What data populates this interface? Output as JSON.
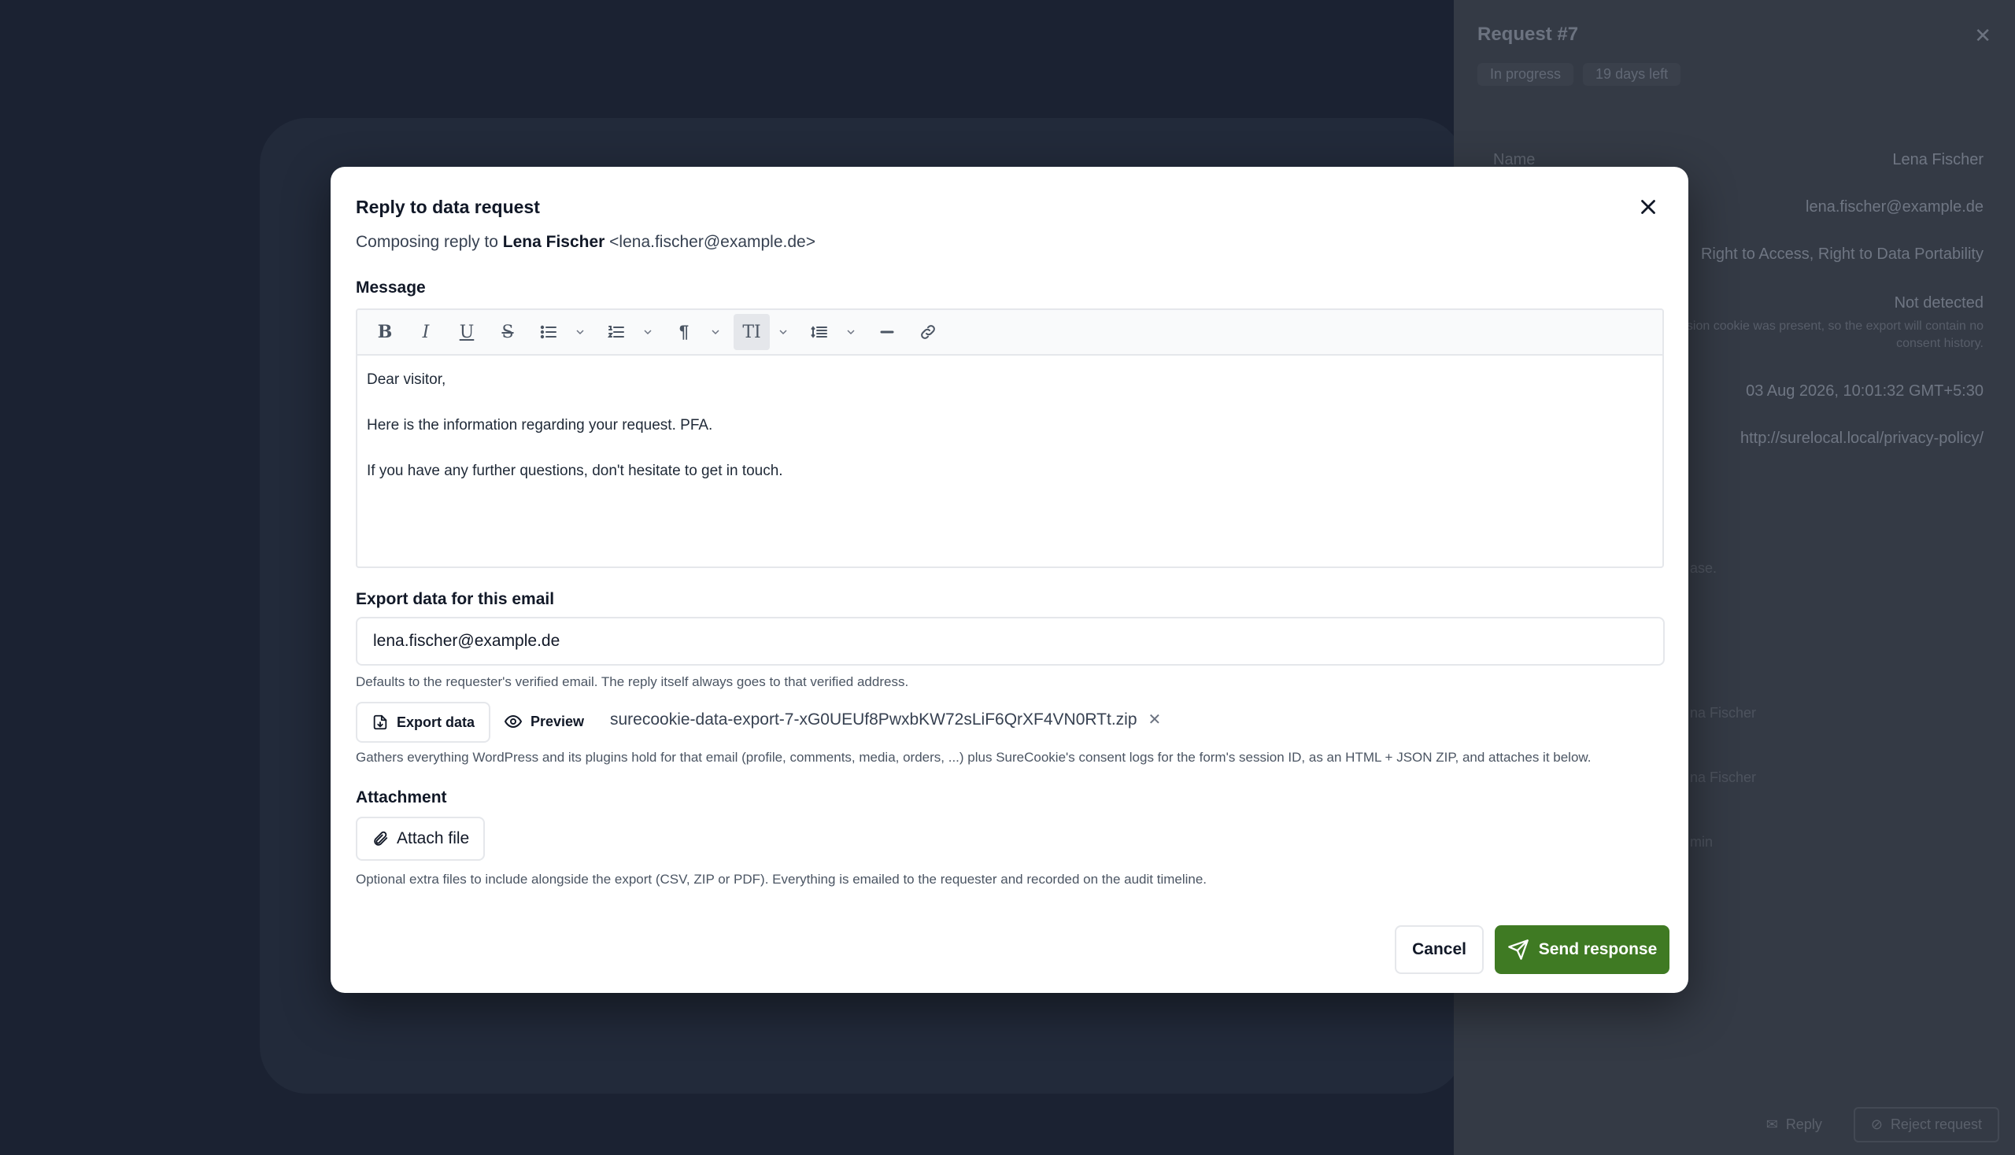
{
  "side_panel": {
    "title": "Request #7",
    "badges": [
      "In progress",
      "19 days left"
    ],
    "rows": [
      {
        "label": "Name",
        "value": "Lena Fischer"
      },
      {
        "label": "",
        "value": "lena.fischer@example.de"
      },
      {
        "label": "",
        "value": "Right to Access, Right to Data Portability"
      },
      {
        "label": "",
        "value": "Not detected"
      },
      {
        "label": "",
        "value": "03 Aug 2026, 10:01:32 GMT+5:30"
      },
      {
        "label": "",
        "value": "http://surelocal.local/privacy-policy/"
      }
    ],
    "session_note": "session cookie was present, so the export will contain no consent history.",
    "faint_texts": [
      "ase.",
      "na Fischer",
      "na Fischer",
      "min"
    ],
    "footer": {
      "reply_label": "Reply",
      "reject_label": "Reject request"
    }
  },
  "modal": {
    "title": "Reply to data request",
    "subtitle_prefix": "Composing reply to ",
    "recipient_name": "Lena Fischer",
    "recipient_email": "<lena.fischer@example.de>",
    "message_label": "Message",
    "toolbar": {
      "bold": "B",
      "italic": "I",
      "underline": "U",
      "strike": "S",
      "paragraph": "¶",
      "text_size": "TI"
    },
    "message_lines": [
      "Dear visitor,",
      "Here is the information regarding your request. PFA.",
      "If you have any further questions, don't hesitate to get in touch."
    ],
    "export_label": "Export data for this email",
    "export_email_value": "lena.fischer@example.de",
    "export_help": "Defaults to the requester's verified email. The reply itself always goes to that verified address.",
    "export_button": "Export data",
    "preview_button": "Preview",
    "export_file": "surecookie-data-export-7-xG0UEUf8PwxbKW72sLiF6QrXF4VN0RTt.zip",
    "export_desc": "Gathers everything WordPress and its plugins hold for that email (profile, comments, media, orders, ...) plus SureCookie's consent logs for the form's session ID, as an HTML + JSON ZIP, and attaches it below.",
    "attachment_label": "Attachment",
    "attach_button": "Attach file",
    "attachment_help": "Optional extra files to include alongside the export (CSV, ZIP or PDF). Everything is emailed to the requester and recorded on the audit timeline.",
    "cancel_button": "Cancel",
    "send_button": "Send response"
  },
  "colors": {
    "primary_green": "#3f7a23",
    "overlay": "#1b2232"
  }
}
